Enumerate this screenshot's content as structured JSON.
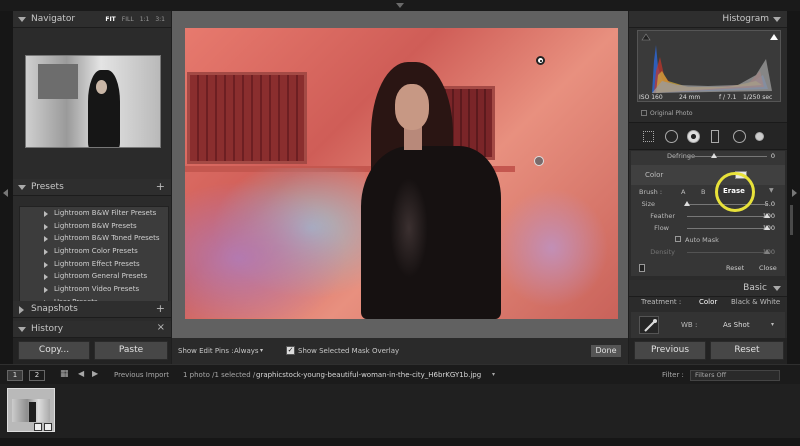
{
  "navigator": {
    "title": "Navigator",
    "zoom": [
      "FIT",
      "FILL",
      "1:1",
      "3:1"
    ],
    "zoom_selected": "FIT"
  },
  "presets": {
    "title": "Presets",
    "items": [
      "Lightroom B&W Filter Presets",
      "Lightroom B&W Presets",
      "Lightroom B&W Toned Presets",
      "Lightroom Color Presets",
      "Lightroom Effect Presets",
      "Lightroom General Presets",
      "Lightroom Video Presets",
      "User Presets"
    ]
  },
  "snapshots": {
    "title": "Snapshots"
  },
  "history": {
    "title": "History"
  },
  "left_buttons": {
    "copy": "Copy...",
    "paste": "Paste"
  },
  "toolbar": {
    "show_pins_label": "Show Edit Pins :",
    "show_pins_value": "Always",
    "show_mask_label": "Show Selected Mask Overlay",
    "done": "Done"
  },
  "histogram": {
    "title": "Histogram",
    "iso": "ISO 160",
    "focal": "24 mm",
    "aperture": "f / 7.1",
    "shutter": "1/250 sec",
    "original_photo": "Original Photo"
  },
  "mask": {
    "defringe_label": "Defringe",
    "defringe_value": "0",
    "color_label": "Color",
    "brush_label": "Brush :",
    "brush_a": "A",
    "brush_b": "B",
    "brush_erase": "Erase",
    "size_label": "Size",
    "size_value": "5.0",
    "feather_label": "Feather",
    "feather_value": "100",
    "flow_label": "Flow",
    "flow_value": "100",
    "auto_mask": "Auto Mask",
    "density_label": "Density",
    "density_value": "100",
    "reset": "Reset",
    "close": "Close"
  },
  "basic": {
    "title": "Basic",
    "treatment_label": "Treatment :",
    "treatment_color": "Color",
    "treatment_bw": "Black & White",
    "wb_label": "WB :",
    "wb_value": "As Shot"
  },
  "right_buttons": {
    "previous": "Previous",
    "reset": "Reset"
  },
  "filmstrip": {
    "page1": "1",
    "page2": "2",
    "previous_import": "Previous Import",
    "count_text": "1 photo /1 selected /",
    "filename": "graphicstock-young-beautiful-woman-in-the-city_H6brKGY1b.jpg",
    "filter_label": "Filter :",
    "filter_value": "Filters Off"
  }
}
